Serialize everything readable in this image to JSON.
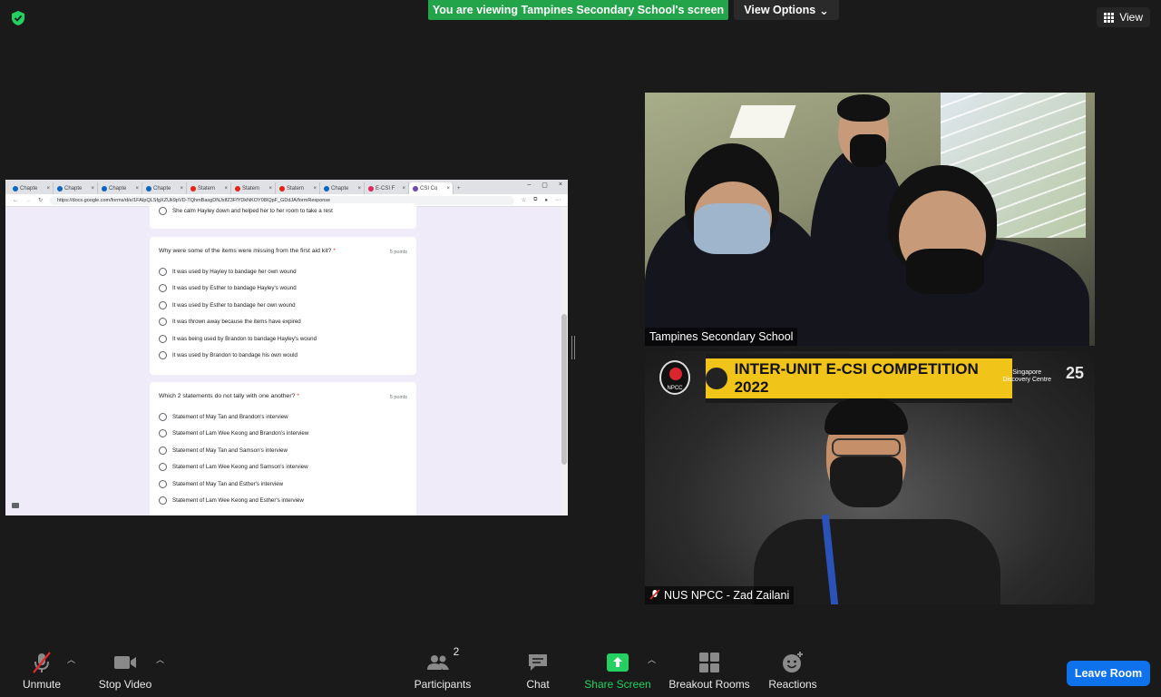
{
  "top": {
    "banner_text": "You are viewing Tampines Secondary School's screen",
    "view_options_label": "View Options",
    "view_label": "View"
  },
  "shared_screen": {
    "tabs": [
      "Chapte",
      "Chapte",
      "Chapte",
      "Chapte",
      "Statem",
      "Statem",
      "Statem",
      "Chapte",
      "E-CSI F",
      "CSI Co"
    ],
    "url": "https://docs.google.com/forms/d/e/1FAIpQLSfgXZUk9pVD-TQhmBasgDNJxlfZ3FfYDkNKOY08IQpF_GDdJA/formResponse",
    "prev_option": "She calm Hayley down and helped her to her room to take a rest",
    "questions": [
      {
        "text": "Why were some of the items were missing from the first aid kit?",
        "required_mark": "*",
        "points": "5 points",
        "options": [
          "It was used by Hayley to bandage her own wound",
          "It was used by Esther to bandage Hayley's wound",
          "It was used by Esther to bandage her own wound",
          "It was thrown away because the items have expired",
          "It was being used by Brandon to bandage Hayley's wound",
          "It was used by Brandon to bandage his own would"
        ]
      },
      {
        "text": "Which 2 statements do not tally with one another?",
        "required_mark": "*",
        "points": "5 points",
        "options": [
          "Statement of May Tan and Brandon's interview",
          "Statement of Lam Wee Keong and Brandon's interview",
          "Statement of May Tan and Samson's interview",
          "Statement of Lam Wee Keong and Samson's interview",
          "Statement of May Tan and Esther's interview",
          "Statement of Lam Wee Keong and Esther's interview"
        ]
      }
    ]
  },
  "videos": {
    "participant1_name": "Tampines Secondary School",
    "participant2_name": "NUS NPCC - Zad Zailani",
    "banner_title": "INTER-UNIT E-CSI COMPETITION 2022",
    "npcc_logo_text": "NPCC",
    "sdc_text_1": "Singapore",
    "sdc_text_2": "Discovery Centre",
    "years_text": "25"
  },
  "toolbar": {
    "unmute": "Unmute",
    "stop_video": "Stop Video",
    "participants": "Participants",
    "participants_count": "2",
    "chat": "Chat",
    "share_screen": "Share Screen",
    "breakout_rooms": "Breakout Rooms",
    "reactions": "Reactions",
    "leave_room": "Leave Room"
  },
  "colors": {
    "banner_green": "#23a34a",
    "leave_blue": "#0e72ed",
    "share_green": "#23d160"
  }
}
